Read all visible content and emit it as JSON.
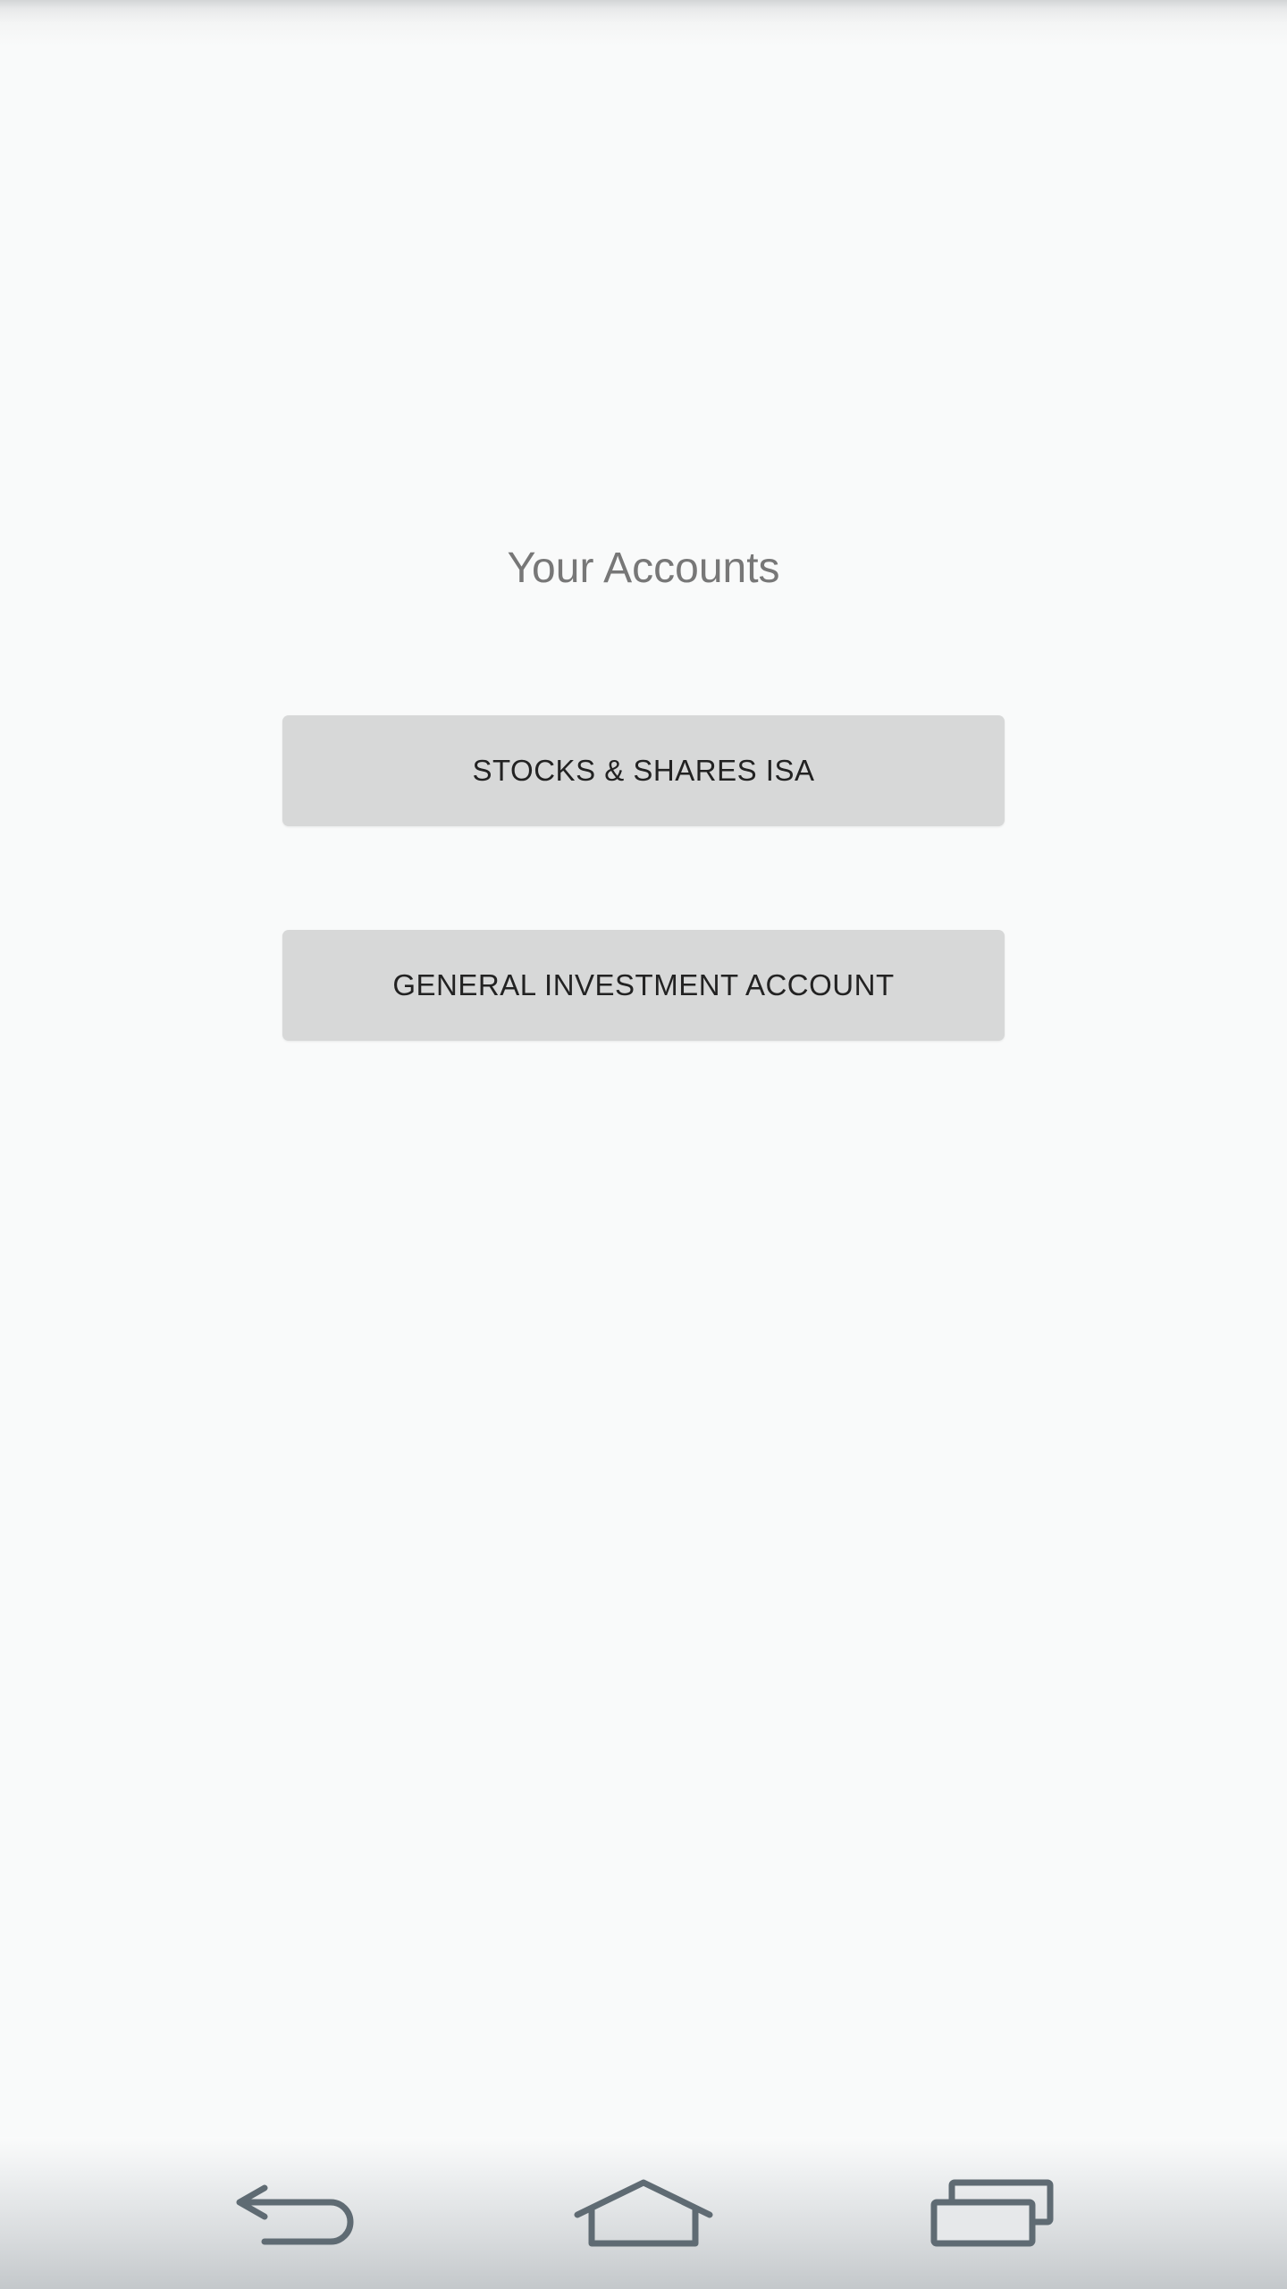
{
  "main": {
    "title": "Your Accounts",
    "buttons": [
      {
        "label": "STOCKS & SHARES ISA"
      },
      {
        "label": "GENERAL INVESTMENT ACCOUNT"
      }
    ]
  },
  "navbar": {
    "icons": [
      "back-icon",
      "home-icon",
      "recents-icon"
    ],
    "icon_color": "#5f6b73"
  },
  "colors": {
    "background": "#f9fafa",
    "button_background": "#d7d8d8",
    "button_text": "#222222",
    "title_text": "#777777"
  }
}
